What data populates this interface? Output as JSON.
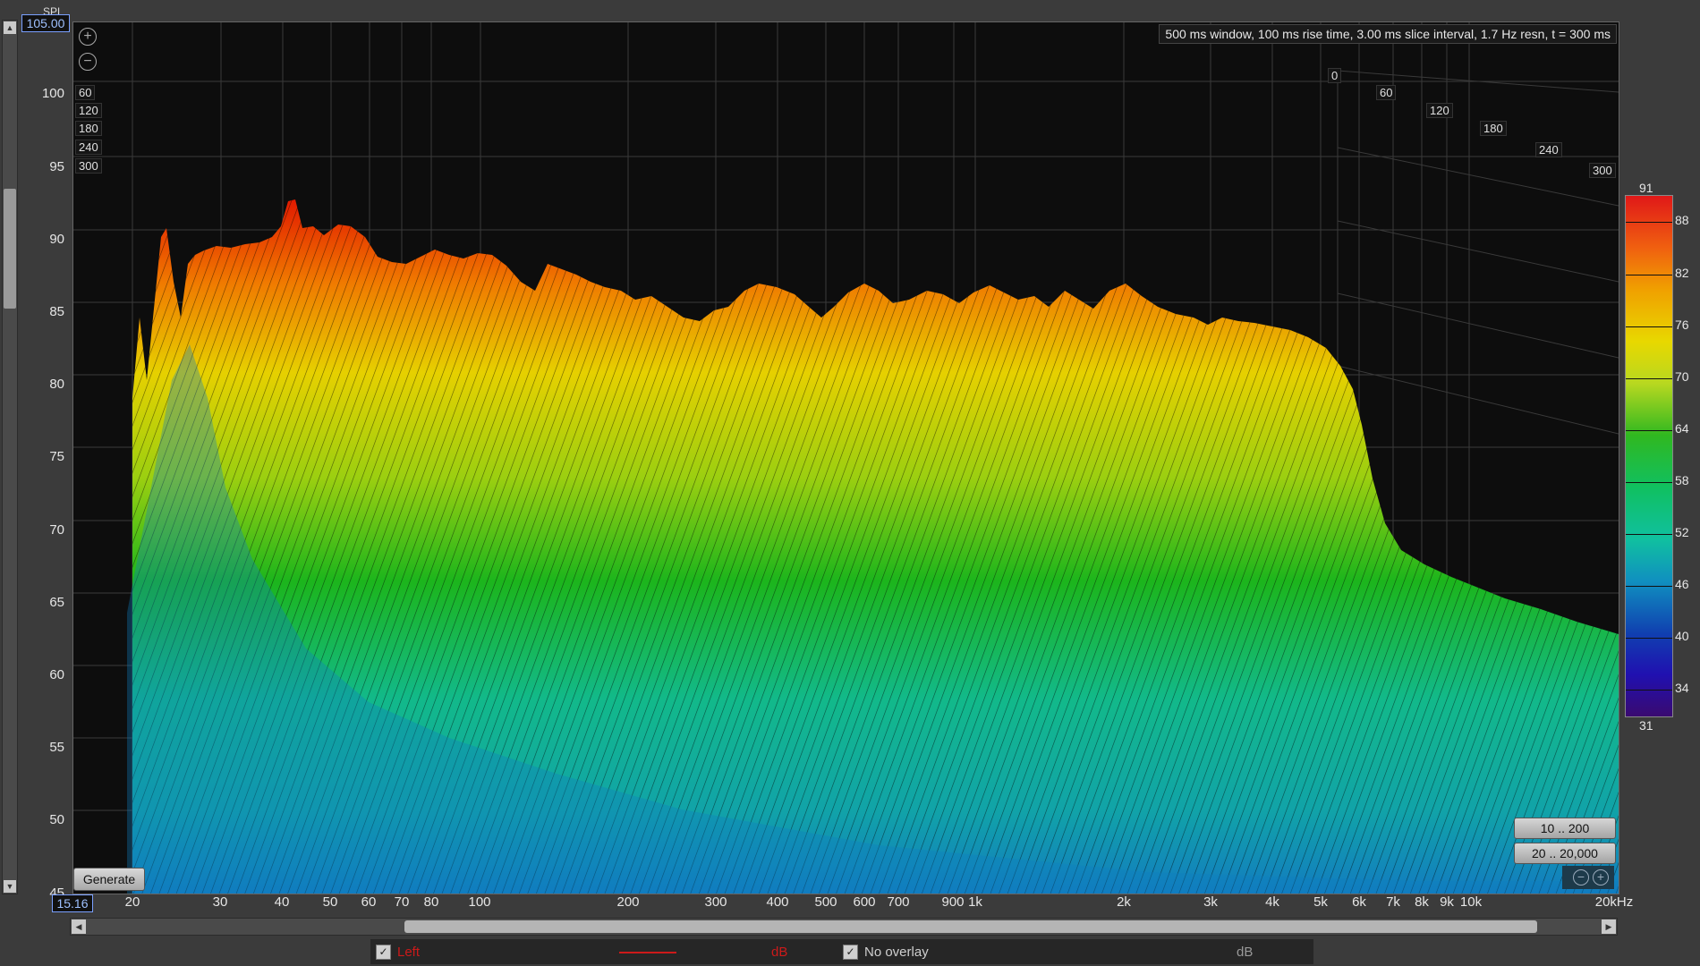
{
  "yaxis": {
    "unit": "SPL",
    "max_value": "105.00",
    "min_value": "15.16",
    "labels": [
      "100",
      "95",
      "90",
      "85",
      "80",
      "75",
      "70",
      "65",
      "60",
      "55",
      "50",
      "45"
    ]
  },
  "info": "500 ms window, 100 ms rise time, 3.00 ms slice interval, 1.7 Hz resn, t = 300 ms",
  "time_axis": {
    "left_labels": [
      "60",
      "120",
      "180",
      "240",
      "300"
    ],
    "right_labels": [
      "0",
      "60",
      "120",
      "180",
      "240",
      "300"
    ]
  },
  "xaxis": {
    "labels": [
      "20",
      "30",
      "40",
      "50",
      "60",
      "70",
      "80",
      "100",
      "200",
      "300",
      "400",
      "500",
      "600",
      "700",
      "900",
      "1k",
      "2k",
      "3k",
      "4k",
      "5k",
      "6k",
      "7k",
      "8k",
      "9k",
      "10k",
      "20kHz"
    ]
  },
  "buttons": {
    "generate": "Generate",
    "range_low": "10 .. 200",
    "range_full": "20 .. 20,000"
  },
  "color_scale": {
    "max": "91",
    "min": "31",
    "ticks": [
      "88",
      "82",
      "76",
      "70",
      "64",
      "58",
      "52",
      "46",
      "40",
      "34"
    ]
  },
  "legend": {
    "left_label": "Left",
    "left_unit": "dB",
    "overlay_label": "No overlay",
    "overlay_unit": "dB",
    "checkmark": "✓"
  },
  "colors": {
    "accent": "#cc0000",
    "background": "#0d0d0d"
  }
}
